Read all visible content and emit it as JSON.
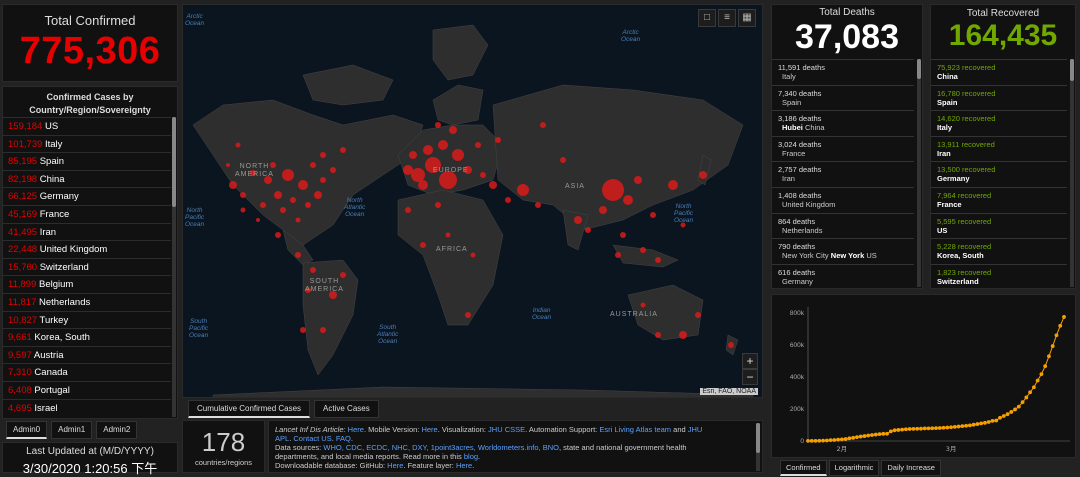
{
  "total_confirmed": {
    "title": "Total Confirmed",
    "value": "775,306"
  },
  "confirmed_list": {
    "title_line1": "Confirmed Cases by",
    "title_line2": "Country/Region/Sovereignty",
    "items": [
      {
        "n": "159,184",
        "c": "US"
      },
      {
        "n": "101,739",
        "c": "Italy"
      },
      {
        "n": "85,195",
        "c": "Spain"
      },
      {
        "n": "82,198",
        "c": "China"
      },
      {
        "n": "66,125",
        "c": "Germany"
      },
      {
        "n": "45,169",
        "c": "France"
      },
      {
        "n": "41,495",
        "c": "Iran"
      },
      {
        "n": "22,448",
        "c": "United Kingdom"
      },
      {
        "n": "15,760",
        "c": "Switzerland"
      },
      {
        "n": "11,899",
        "c": "Belgium"
      },
      {
        "n": "11,817",
        "c": "Netherlands"
      },
      {
        "n": "10,827",
        "c": "Turkey"
      },
      {
        "n": "9,661",
        "c": "Korea, South"
      },
      {
        "n": "9,597",
        "c": "Austria"
      },
      {
        "n": "7,310",
        "c": "Canada"
      },
      {
        "n": "6,408",
        "c": "Portugal"
      },
      {
        "n": "4,695",
        "c": "Israel"
      }
    ]
  },
  "admin_tabs": [
    "Admin0",
    "Admin1",
    "Admin2"
  ],
  "last_updated": {
    "label": "Last Updated at (M/D/YYYY)",
    "value": "3/30/2020 1:20:56 下午"
  },
  "map": {
    "labels": {
      "arctic_ocean_left": "Arctic\nOcean",
      "arctic_ocean_right": "Arctic\nOcean",
      "north_america": "NORTH\nAMERICA",
      "europe": "EUROPE",
      "asia": "ASIA",
      "africa": "AFRICA",
      "south_america": "SOUTH\nAMERICA",
      "australia": "AUSTRALIA",
      "north_atlantic": "North\nAtlantic\nOcean",
      "north_pacific_left": "North\nPacific\nOcean",
      "north_pacific_right": "North\nPacific\nOcean",
      "south_atlantic": "South\nAtlantic\nOcean",
      "south_pacific": "South\nPacific\nOcean",
      "indian_ocean": "Indian\nOcean"
    },
    "attribution": "Esri, FAO, NOAA",
    "zoom_in": "+",
    "zoom_out": "−",
    "tools": [
      "bookmark-icon",
      "list-icon",
      "grid-icon"
    ]
  },
  "map_tabs": [
    "Cumulative Confirmed Cases",
    "Active Cases"
  ],
  "country_count": {
    "value": "178",
    "label": "countries/regions"
  },
  "info": {
    "line1a": "Lancet Inf Dis Article: ",
    "line1b": "Here",
    "line1c": ". Mobile Version: ",
    "line1d": "Here",
    "line1e": ". Visualization: ",
    "line1f": "JHU CSSE",
    "line1g": ". Automation Support: ",
    "line1h": "Esri Living Atlas team",
    "line1i": " and ",
    "line1j": "JHU",
    "line2a": "APL",
    "line2b": ". ",
    "line2c": "Contact US",
    "line2d": ". ",
    "line2e": "FAQ",
    "line2f": ".",
    "line3a": "Data sources: ",
    "line3b": "WHO, CDC, ECDC, NHC, DXY, 1point3acres, Worldometers.info, BNO",
    "line3c": ", state and national government health",
    "line4a": "departments, and local media reports.  Read more in this ",
    "line4b": "blog",
    "line4c": ".",
    "line5a": "Downloadable database: GitHub: ",
    "line5b": "Here",
    "line5c": ". Feature layer: ",
    "line5d": "Here",
    "line5e": "."
  },
  "total_deaths": {
    "title": "Total Deaths",
    "value": "37,083",
    "items": [
      {
        "n": "11,591 deaths",
        "s": "Italy"
      },
      {
        "n": "7,340 deaths",
        "s": "Spain"
      },
      {
        "n": "3,186 deaths",
        "b": "Hubei",
        "s": "China"
      },
      {
        "n": "3,024 deaths",
        "s": "France"
      },
      {
        "n": "2,757 deaths",
        "s": "Iran"
      },
      {
        "n": "1,408 deaths",
        "s": "United Kingdom"
      },
      {
        "n": "864 deaths",
        "s": "Netherlands"
      },
      {
        "n": "790 deaths",
        "pre": "New York City",
        "b": "New York",
        "s": "US"
      },
      {
        "n": "616 deaths",
        "s": "Germany"
      }
    ]
  },
  "total_recovered": {
    "title": "Total Recovered",
    "value": "164,435",
    "items": [
      {
        "n": "75,923 recovered",
        "c": "China"
      },
      {
        "n": "16,780 recovered",
        "c": "Spain"
      },
      {
        "n": "14,620 recovered",
        "c": "Italy"
      },
      {
        "n": "13,911 recovered",
        "c": "Iran"
      },
      {
        "n": "13,500 recovered",
        "c": "Germany"
      },
      {
        "n": "7,964 recovered",
        "c": "France"
      },
      {
        "n": "5,595 recovered",
        "c": "US"
      },
      {
        "n": "5,228 recovered",
        "c": "Korea, South"
      },
      {
        "n": "1,823 recovered",
        "c": "Switzerland"
      }
    ]
  },
  "chart_tabs": [
    "Confirmed",
    "Logarithmic",
    "Daily Increase"
  ],
  "chart_data": {
    "type": "line",
    "title": "",
    "xlabel": "",
    "ylabel": "",
    "yticks": [
      "0",
      "200k",
      "400k",
      "600k",
      "800k"
    ],
    "ylim": [
      0,
      800000
    ],
    "xtick_labels": [
      "2月",
      "3月"
    ],
    "xtick_days": [
      9,
      38
    ],
    "x": [
      0,
      1,
      2,
      3,
      4,
      5,
      6,
      7,
      8,
      9,
      10,
      11,
      12,
      13,
      14,
      15,
      16,
      17,
      18,
      19,
      20,
      21,
      22,
      23,
      24,
      25,
      26,
      27,
      28,
      29,
      30,
      31,
      32,
      33,
      34,
      35,
      36,
      37,
      38,
      39,
      40,
      41,
      42,
      43,
      44,
      45,
      46,
      47,
      48,
      49,
      50,
      51,
      52,
      53,
      54,
      55,
      56,
      57,
      58,
      59,
      60,
      61,
      62,
      63,
      64,
      65,
      66,
      67,
      68
    ],
    "values": [
      555,
      654,
      941,
      1434,
      2118,
      2927,
      5578,
      6166,
      8234,
      9927,
      12038,
      16787,
      19881,
      23892,
      27635,
      30794,
      34391,
      37120,
      40150,
      42762,
      44802,
      45221,
      60368,
      66885,
      69030,
      71224,
      73258,
      75136,
      75639,
      76197,
      76819,
      78572,
      78958,
      79561,
      80406,
      81388,
      82746,
      84112,
      86011,
      88369,
      90306,
      92840,
      95120,
      97886,
      101801,
      105847,
      109821,
      113590,
      118620,
      125865,
      128343,
      145193,
      156097,
      167449,
      181546,
      197168,
      214915,
      242713,
      272167,
      304528,
      335957,
      378287,
      418045,
      467653,
      529591,
      593291,
      660706,
      720117,
      775306
    ],
    "color": "#f5a000",
    "grid": false
  }
}
